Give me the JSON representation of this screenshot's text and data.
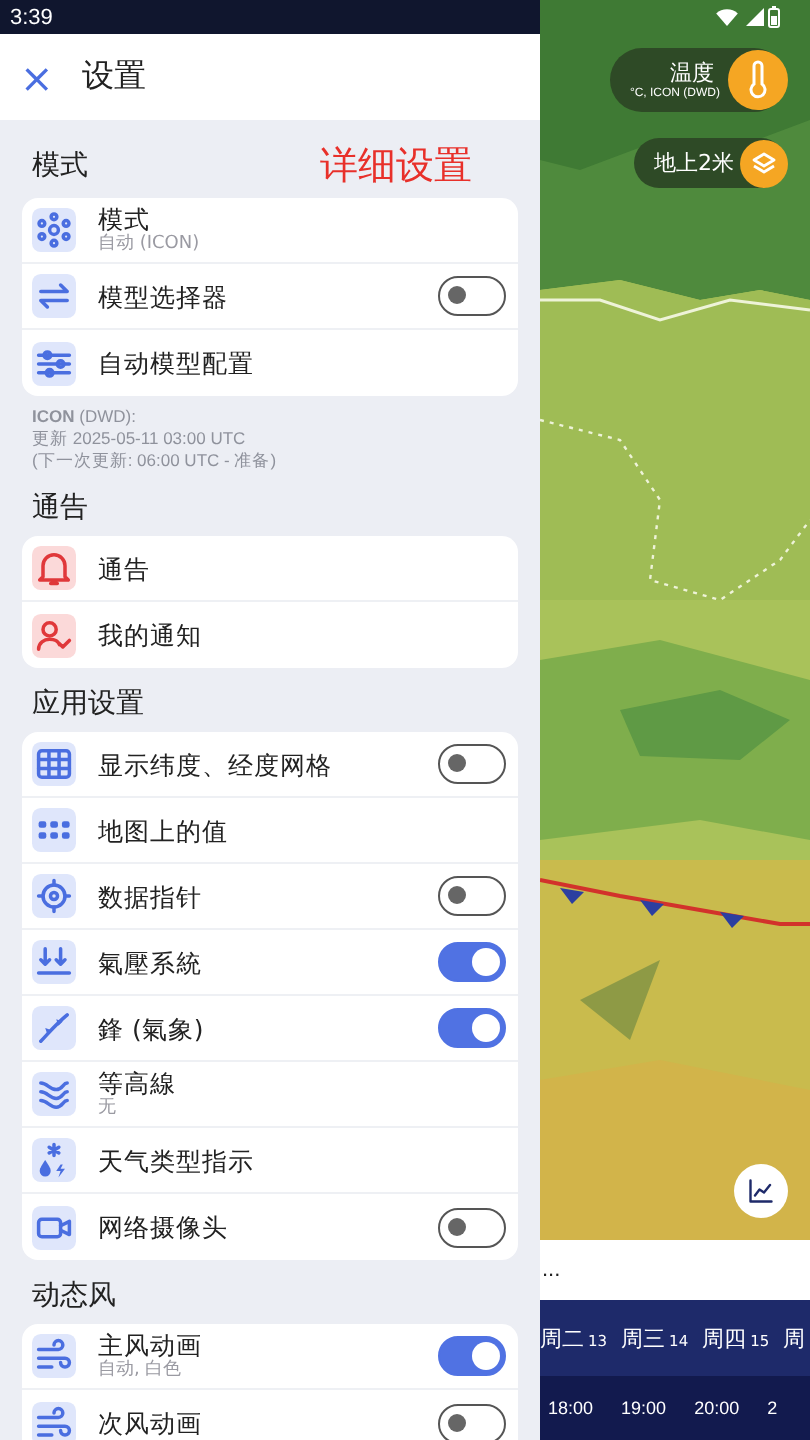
{
  "status_bar": {
    "time": "3:39"
  },
  "header": {
    "close": "×",
    "title": "设置"
  },
  "annotation": "详细设置",
  "sections": [
    {
      "title": "模式",
      "rows": [
        {
          "label": "模式",
          "sublabel": "自动 (ICON)"
        },
        {
          "label": "模型选择器",
          "on": false
        },
        {
          "label": "自动模型配置"
        }
      ],
      "note": [
        "**ICON** (DWD):",
        "更新 2025-05-11 03:00 UTC",
        "(下一次更新: 06:00 UTC - 准备)"
      ]
    },
    {
      "title": "通告",
      "rows": [
        {
          "label": "通告"
        },
        {
          "label": "我的通知"
        }
      ]
    },
    {
      "title": "应用设置",
      "rows": [
        {
          "label": "显示纬度、经度网格",
          "on": false
        },
        {
          "label": "地图上的值"
        },
        {
          "label": "数据指针",
          "on": false
        },
        {
          "label": "氣壓系統",
          "on": true
        },
        {
          "label": "鋒 (氣象)",
          "on": true
        },
        {
          "label": "等高線",
          "sublabel": "无"
        },
        {
          "label": "天气类型指示"
        },
        {
          "label": "网络摄像头",
          "on": false
        }
      ]
    },
    {
      "title": "动态风",
      "rows": [
        {
          "label": "主风动画",
          "sublabel": "自动, 白色",
          "on": true
        },
        {
          "label": "次风动画",
          "on": false
        }
      ]
    }
  ],
  "map": {
    "layer": {
      "title": "温度",
      "subtitle": "°C, ICON (DWD)"
    },
    "level": "地上2米",
    "more": "...",
    "days": [
      {
        "day": "周二",
        "date": "13"
      },
      {
        "day": "周三",
        "date": "14"
      },
      {
        "day": "周四",
        "date": "15"
      },
      {
        "day": "周"
      }
    ],
    "times": [
      "18:00",
      "19:00",
      "20:00",
      "2"
    ]
  }
}
